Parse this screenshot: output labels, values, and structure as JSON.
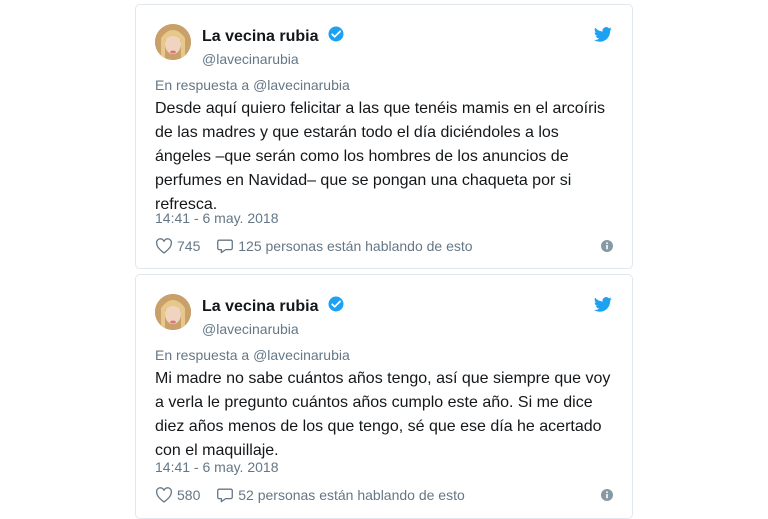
{
  "tweets": [
    {
      "author": {
        "name": "La vecina rubia",
        "handle": "@lavecinarubia",
        "verified": true
      },
      "reply_prefix": "En respuesta a",
      "reply_handle": "@lavecinarubia",
      "text": "Desde aquí quiero felicitar a las que tenéis mamis en el  arcoíris\nde las madres y que estarán todo el día diciéndoles a los\nángeles –que serán como los hombres de los anuncios de\nperfumes en  Navidad– que se pongan una chaqueta por si\nrefresca.",
      "timestamp": "14:41 - 6 may. 2018",
      "likes": "745",
      "replies_text": "125 personas están hablando de esto"
    },
    {
      "author": {
        "name": "La vecina rubia",
        "handle": "@lavecinarubia",
        "verified": true
      },
      "reply_prefix": "En respuesta a",
      "reply_handle": "@lavecinarubia",
      "text": "Mi madre no sabe cuántos años tengo, así que siempre que voy\na verla le pregunto cuántos años cumplo este año. Si me dice\ndiez años  menos de los que tengo, sé que ese día he acertado\ncon el maquillaje.",
      "timestamp": "14:41 - 6 may. 2018",
      "likes": "580",
      "replies_text": "52 personas están hablando de esto"
    }
  ],
  "colors": {
    "twitter_blue": "#1da1f2",
    "secondary_text": "#657786",
    "border": "#e1e8ed"
  },
  "icons": [
    "twitter-bird-icon",
    "verified-badge-icon",
    "heart-icon",
    "reply-bubble-icon",
    "info-icon"
  ]
}
